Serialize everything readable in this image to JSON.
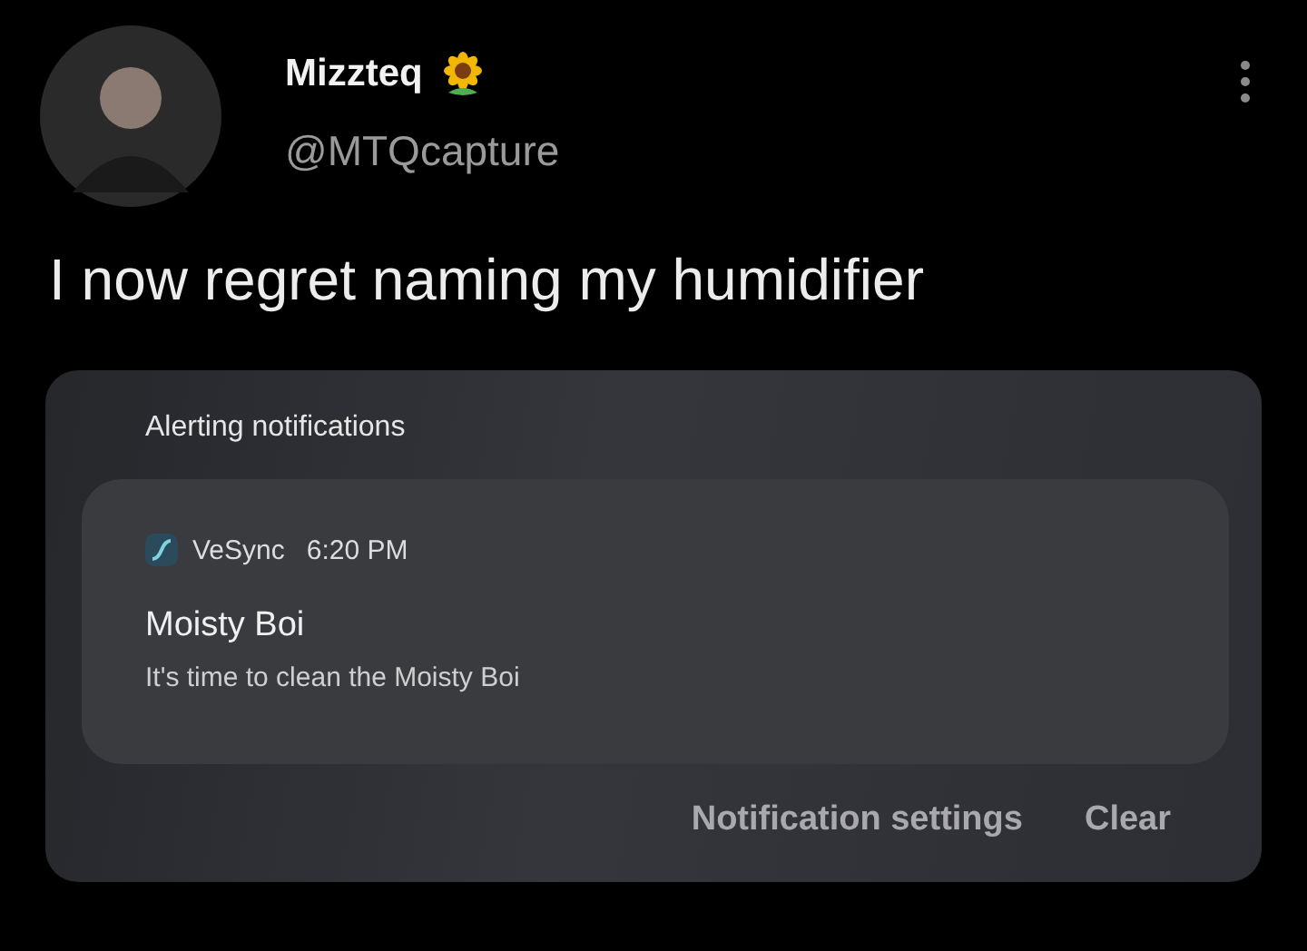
{
  "author": {
    "name": "Mizzteq",
    "handle": "@MTQcapture"
  },
  "tweet": {
    "text": "I now regret naming my humidifier"
  },
  "panel": {
    "title": "Alerting notifications",
    "notification": {
      "app": "VeSync",
      "time": "6:20 PM",
      "title": "Moisty Boi",
      "body": "It's time to clean the Moisty Boi"
    },
    "actions": [
      "Notification settings",
      "Clear"
    ]
  }
}
